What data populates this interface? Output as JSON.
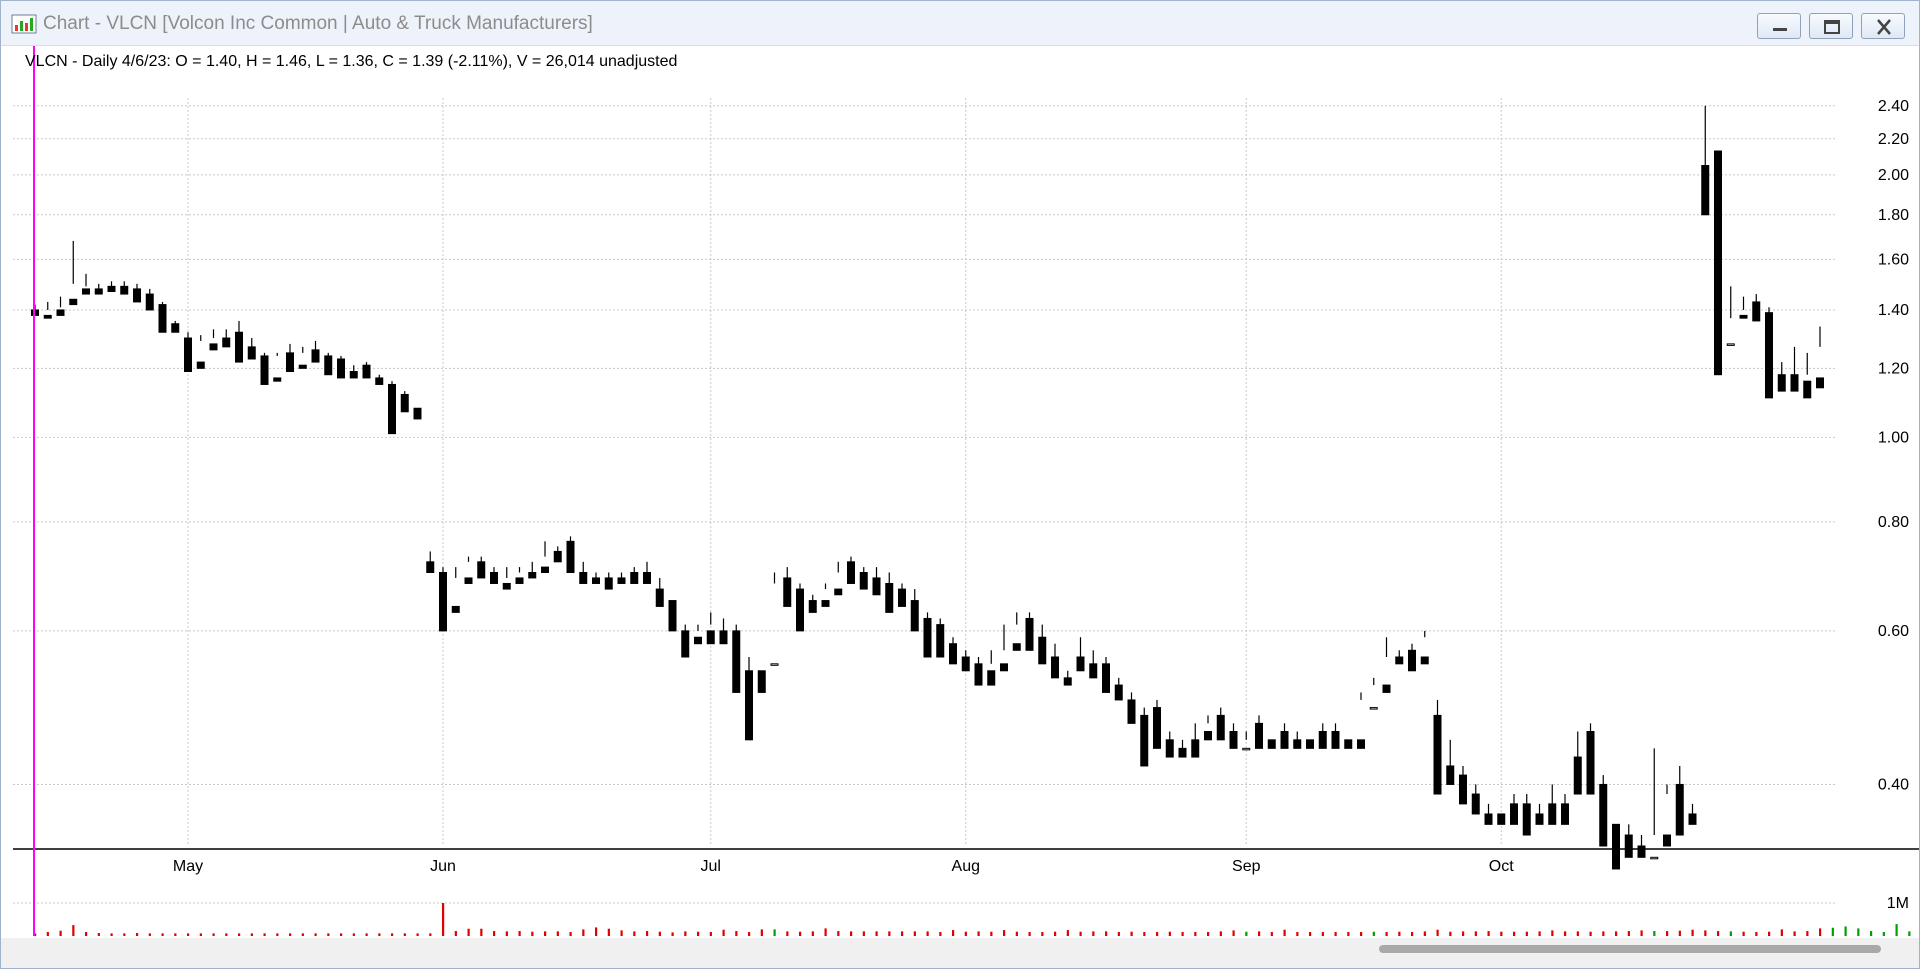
{
  "window": {
    "title": "Chart - VLCN [Volcon Inc Common | Auto & Truck Manufacturers]",
    "controls": [
      "minimize",
      "restore",
      "close"
    ]
  },
  "info_line": "VLCN - Daily 4/6/23:  O = 1.40,  H = 1.46,  L = 1.36,  C = 1.39 (-2.11%), V = 26,014  unadjusted",
  "colors": {
    "cursor_line": "#ff00ff",
    "volume_up": "#00a000",
    "volume_down": "#e00000",
    "grid": "#c8c8c8",
    "candle": "#000000"
  },
  "chart_data": {
    "type": "candlestick",
    "symbol": "VLCN",
    "scale": "log",
    "y_ticks": [
      "2.40",
      "2.20",
      "2.00",
      "1.80",
      "1.60",
      "1.40",
      "1.20",
      "1.00",
      "0.80",
      "0.60",
      "0.40"
    ],
    "ylim": [
      0.34,
      2.45
    ],
    "x_labels": [
      {
        "label": "May",
        "index": 12
      },
      {
        "label": "Jun",
        "index": 32
      },
      {
        "label": "Jul",
        "index": 53
      },
      {
        "label": "Aug",
        "index": 73
      },
      {
        "label": "Sep",
        "index": 95
      },
      {
        "label": "Oct",
        "index": 115
      }
    ],
    "volume_tick": "1M",
    "volume_max": 1000000,
    "candles": [
      [
        1.4,
        1.42,
        1.39,
        1.38
      ],
      [
        1.38,
        1.43,
        1.4,
        1.37
      ],
      [
        1.4,
        1.45,
        1.41,
        1.38
      ],
      [
        1.44,
        1.68,
        1.5,
        1.42
      ],
      [
        1.48,
        1.54,
        1.49,
        1.46
      ],
      [
        1.48,
        1.5,
        1.48,
        1.46
      ],
      [
        1.49,
        1.51,
        1.49,
        1.47
      ],
      [
        1.49,
        1.51,
        1.48,
        1.46
      ],
      [
        1.48,
        1.5,
        1.45,
        1.43
      ],
      [
        1.46,
        1.48,
        1.42,
        1.4
      ],
      [
        1.42,
        1.43,
        1.34,
        1.32
      ],
      [
        1.35,
        1.36,
        1.34,
        1.32
      ],
      [
        1.3,
        1.32,
        1.24,
        1.19
      ],
      [
        1.22,
        1.31,
        1.29,
        1.2
      ],
      [
        1.28,
        1.33,
        1.3,
        1.26
      ],
      [
        1.3,
        1.33,
        1.29,
        1.27
      ],
      [
        1.32,
        1.36,
        1.24,
        1.22
      ],
      [
        1.27,
        1.3,
        1.26,
        1.23
      ],
      [
        1.24,
        1.25,
        1.16,
        1.15
      ],
      [
        1.17,
        1.25,
        1.24,
        1.16
      ],
      [
        1.25,
        1.28,
        1.2,
        1.19
      ],
      [
        1.21,
        1.27,
        1.25,
        1.2
      ],
      [
        1.26,
        1.29,
        1.26,
        1.22
      ],
      [
        1.24,
        1.25,
        1.2,
        1.18
      ],
      [
        1.23,
        1.24,
        1.18,
        1.17
      ],
      [
        1.19,
        1.21,
        1.18,
        1.17
      ],
      [
        1.21,
        1.22,
        1.18,
        1.17
      ],
      [
        1.17,
        1.18,
        1.16,
        1.15
      ],
      [
        1.15,
        1.16,
        1.08,
        1.01
      ],
      [
        1.12,
        1.13,
        1.08,
        1.07
      ],
      [
        1.08,
        1.08,
        1.07,
        1.05
      ],
      [
        0.72,
        0.74,
        0.71,
        0.7
      ],
      [
        0.7,
        0.71,
        0.66,
        0.6
      ],
      [
        0.64,
        0.71,
        0.69,
        0.63
      ],
      [
        0.69,
        0.73,
        0.72,
        0.68
      ],
      [
        0.72,
        0.73,
        0.7,
        0.69
      ],
      [
        0.7,
        0.71,
        0.69,
        0.68
      ],
      [
        0.68,
        0.71,
        0.69,
        0.67
      ],
      [
        0.69,
        0.71,
        0.7,
        0.68
      ],
      [
        0.7,
        0.72,
        0.7,
        0.69
      ],
      [
        0.71,
        0.76,
        0.73,
        0.7
      ],
      [
        0.74,
        0.75,
        0.74,
        0.72
      ],
      [
        0.76,
        0.77,
        0.71,
        0.7
      ],
      [
        0.7,
        0.72,
        0.69,
        0.68
      ],
      [
        0.69,
        0.7,
        0.68,
        0.68
      ],
      [
        0.69,
        0.7,
        0.68,
        0.67
      ],
      [
        0.69,
        0.7,
        0.68,
        0.68
      ],
      [
        0.7,
        0.71,
        0.69,
        0.68
      ],
      [
        0.7,
        0.72,
        0.69,
        0.68
      ],
      [
        0.67,
        0.69,
        0.65,
        0.64
      ],
      [
        0.65,
        0.65,
        0.61,
        0.6
      ],
      [
        0.6,
        0.61,
        0.58,
        0.56
      ],
      [
        0.59,
        0.61,
        0.6,
        0.58
      ],
      [
        0.6,
        0.63,
        0.61,
        0.58
      ],
      [
        0.6,
        0.62,
        0.59,
        0.58
      ],
      [
        0.6,
        0.61,
        0.55,
        0.51
      ],
      [
        0.54,
        0.56,
        0.53,
        0.45
      ],
      [
        0.54,
        0.55,
        0.55,
        0.51
      ],
      [
        0.55,
        0.7,
        0.68,
        0.55
      ],
      [
        0.69,
        0.71,
        0.66,
        0.64
      ],
      [
        0.67,
        0.68,
        0.63,
        0.6
      ],
      [
        0.65,
        0.66,
        0.65,
        0.63
      ],
      [
        0.65,
        0.68,
        0.67,
        0.64
      ],
      [
        0.67,
        0.72,
        0.7,
        0.66
      ],
      [
        0.72,
        0.73,
        0.69,
        0.68
      ],
      [
        0.7,
        0.71,
        0.68,
        0.67
      ],
      [
        0.69,
        0.71,
        0.67,
        0.66
      ],
      [
        0.68,
        0.7,
        0.64,
        0.63
      ],
      [
        0.67,
        0.68,
        0.66,
        0.64
      ],
      [
        0.65,
        0.67,
        0.61,
        0.6
      ],
      [
        0.62,
        0.63,
        0.58,
        0.56
      ],
      [
        0.61,
        0.62,
        0.57,
        0.56
      ],
      [
        0.58,
        0.59,
        0.56,
        0.55
      ],
      [
        0.56,
        0.57,
        0.55,
        0.54
      ],
      [
        0.55,
        0.56,
        0.54,
        0.52
      ],
      [
        0.54,
        0.57,
        0.55,
        0.52
      ],
      [
        0.55,
        0.61,
        0.57,
        0.54
      ],
      [
        0.58,
        0.63,
        0.61,
        0.57
      ],
      [
        0.62,
        0.63,
        0.59,
        0.57
      ],
      [
        0.59,
        0.61,
        0.58,
        0.55
      ],
      [
        0.56,
        0.58,
        0.54,
        0.53
      ],
      [
        0.53,
        0.54,
        0.53,
        0.52
      ],
      [
        0.56,
        0.59,
        0.55,
        0.54
      ],
      [
        0.55,
        0.57,
        0.54,
        0.53
      ],
      [
        0.55,
        0.56,
        0.52,
        0.51
      ],
      [
        0.52,
        0.53,
        0.51,
        0.5
      ],
      [
        0.5,
        0.51,
        0.48,
        0.47
      ],
      [
        0.48,
        0.49,
        0.46,
        0.42
      ],
      [
        0.49,
        0.5,
        0.46,
        0.44
      ],
      [
        0.45,
        0.46,
        0.44,
        0.43
      ],
      [
        0.44,
        0.45,
        0.44,
        0.43
      ],
      [
        0.45,
        0.47,
        0.44,
        0.43
      ],
      [
        0.46,
        0.48,
        0.47,
        0.45
      ],
      [
        0.48,
        0.49,
        0.46,
        0.45
      ],
      [
        0.46,
        0.47,
        0.44,
        0.44
      ],
      [
        0.44,
        0.46,
        0.45,
        0.44
      ],
      [
        0.47,
        0.48,
        0.45,
        0.44
      ],
      [
        0.45,
        0.46,
        0.46,
        0.44
      ],
      [
        0.46,
        0.47,
        0.46,
        0.44
      ],
      [
        0.45,
        0.46,
        0.45,
        0.44
      ],
      [
        0.45,
        0.46,
        0.46,
        0.44
      ],
      [
        0.46,
        0.47,
        0.45,
        0.44
      ],
      [
        0.46,
        0.47,
        0.45,
        0.44
      ],
      [
        0.45,
        0.46,
        0.46,
        0.44
      ],
      [
        0.45,
        0.51,
        0.5,
        0.44
      ],
      [
        0.49,
        0.53,
        0.52,
        0.49
      ],
      [
        0.52,
        0.59,
        0.56,
        0.51
      ],
      [
        0.56,
        0.57,
        0.56,
        0.55
      ],
      [
        0.57,
        0.58,
        0.55,
        0.54
      ],
      [
        0.56,
        0.6,
        0.59,
        0.55
      ],
      [
        0.48,
        0.5,
        0.39,
        0.39
      ],
      [
        0.42,
        0.45,
        0.41,
        0.4
      ],
      [
        0.41,
        0.42,
        0.39,
        0.38
      ],
      [
        0.39,
        0.4,
        0.38,
        0.37
      ],
      [
        0.37,
        0.38,
        0.37,
        0.36
      ],
      [
        0.37,
        0.38,
        0.38,
        0.36
      ],
      [
        0.38,
        0.39,
        0.36,
        0.36
      ],
      [
        0.38,
        0.39,
        0.36,
        0.35
      ],
      [
        0.37,
        0.38,
        0.36,
        0.36
      ],
      [
        0.38,
        0.4,
        0.37,
        0.36
      ],
      [
        0.38,
        0.39,
        0.37,
        0.36
      ],
      [
        0.43,
        0.46,
        0.39,
        0.39
      ],
      [
        0.46,
        0.47,
        0.4,
        0.39
      ],
      [
        0.4,
        0.41,
        0.34,
        0.34
      ],
      [
        0.36,
        0.36,
        0.33,
        0.32
      ],
      [
        0.35,
        0.36,
        0.34,
        0.33
      ],
      [
        0.34,
        0.35,
        0.33,
        0.33
      ],
      [
        0.33,
        0.44,
        0.35,
        0.33
      ],
      [
        0.35,
        0.4,
        0.39,
        0.34
      ],
      [
        0.4,
        0.42,
        0.37,
        0.35
      ],
      [
        0.37,
        0.38,
        0.37,
        0.36
      ],
      [
        2.05,
        2.4,
        1.88,
        1.8
      ],
      [
        2.13,
        2.13,
        1.31,
        1.18
      ],
      [
        1.28,
        1.49,
        1.37,
        1.28
      ],
      [
        1.38,
        1.45,
        1.4,
        1.37
      ],
      [
        1.43,
        1.46,
        1.38,
        1.36
      ],
      [
        1.39,
        1.41,
        1.19,
        1.11
      ],
      [
        1.18,
        1.22,
        1.17,
        1.13
      ],
      [
        1.18,
        1.27,
        1.16,
        1.13
      ],
      [
        1.16,
        1.25,
        1.18,
        1.11
      ],
      [
        1.17,
        1.34,
        1.27,
        1.14
      ]
    ],
    "volumes": [
      80000,
      120000,
      160000,
      330000,
      120000,
      90000,
      80000,
      80000,
      90000,
      80000,
      80000,
      80000,
      80000,
      80000,
      80000,
      80000,
      80000,
      80000,
      80000,
      80000,
      80000,
      80000,
      80000,
      80000,
      80000,
      80000,
      80000,
      80000,
      80000,
      80000,
      80000,
      80000,
      1000000,
      150000,
      220000,
      220000,
      150000,
      140000,
      150000,
      130000,
      140000,
      140000,
      120000,
      200000,
      260000,
      220000,
      170000,
      140000,
      150000,
      130000,
      110000,
      140000,
      130000,
      120000,
      190000,
      150000,
      120000,
      200000,
      200000,
      140000,
      130000,
      140000,
      230000,
      150000,
      140000,
      140000,
      140000,
      140000,
      140000,
      140000,
      140000,
      120000,
      180000,
      130000,
      140000,
      130000,
      180000,
      130000,
      120000,
      120000,
      130000,
      180000,
      130000,
      140000,
      140000,
      120000,
      130000,
      120000,
      120000,
      130000,
      120000,
      120000,
      120000,
      140000,
      170000,
      130000,
      140000,
      120000,
      190000,
      120000,
      120000,
      120000,
      120000,
      120000,
      120000,
      130000,
      120000,
      130000,
      120000,
      140000,
      190000,
      130000,
      140000,
      140000,
      150000,
      130000,
      130000,
      130000,
      140000,
      170000,
      140000,
      140000,
      130000,
      140000,
      140000,
      150000,
      170000,
      150000,
      150000,
      160000,
      190000,
      170000,
      150000,
      140000,
      130000,
      120000,
      130000,
      200000,
      140000,
      150000,
      230000,
      250000,
      290000,
      230000,
      150000,
      120000,
      360000,
      140000,
      180000,
      170000
    ]
  }
}
